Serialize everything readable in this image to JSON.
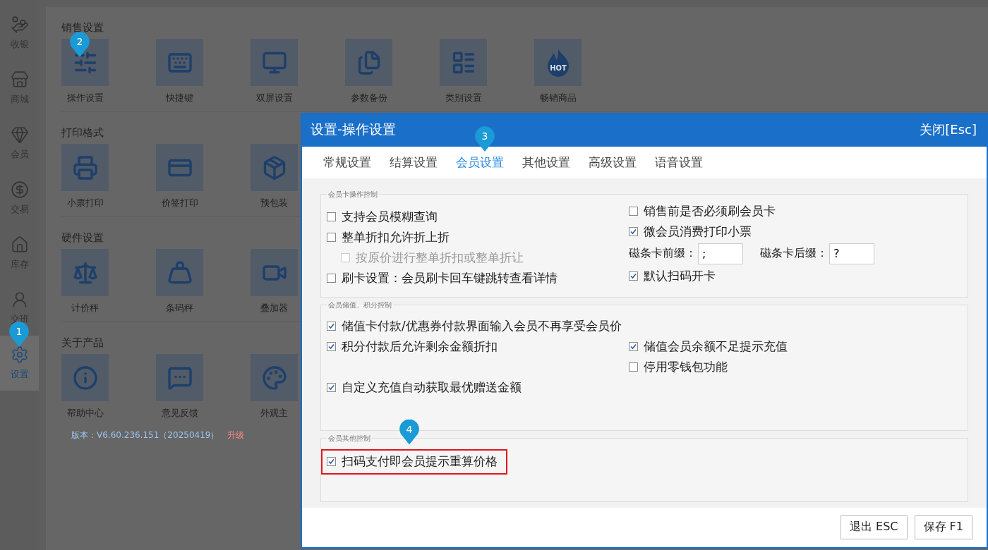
{
  "sidebar": {
    "items": [
      {
        "label": "收银",
        "selected": false
      },
      {
        "label": "商城",
        "selected": false
      },
      {
        "label": "会员",
        "selected": false
      },
      {
        "label": "交易",
        "selected": false
      },
      {
        "label": "库存",
        "selected": false
      },
      {
        "label": "交班",
        "selected": false
      },
      {
        "label": "设置",
        "selected": true,
        "callout": "1"
      }
    ]
  },
  "settings_page": {
    "sections": [
      {
        "title": "销售设置",
        "tiles": [
          {
            "label": "操作设置",
            "callout": "2"
          },
          {
            "label": "快捷键"
          },
          {
            "label": "双屏设置"
          },
          {
            "label": "参数备份"
          },
          {
            "label": "类别设置"
          },
          {
            "label": "畅销商品",
            "icon_text": "HOT"
          }
        ]
      },
      {
        "title": "打印格式",
        "tiles": [
          {
            "label": "小票打印"
          },
          {
            "label": "价签打印"
          },
          {
            "label": "预包装"
          }
        ]
      },
      {
        "title": "硬件设置",
        "tiles": [
          {
            "label": "计价秤"
          },
          {
            "label": "条码秤"
          },
          {
            "label": "叠加器"
          }
        ]
      },
      {
        "title": "关于产品",
        "tiles": [
          {
            "label": "帮助中心"
          },
          {
            "label": "意见反馈"
          },
          {
            "label": "外观主"
          }
        ]
      }
    ],
    "version": {
      "text": "版本：V6.60.236.151（20250419）",
      "link": "升级"
    }
  },
  "dialog": {
    "title": "设置-操作设置",
    "close": "关闭[Esc]",
    "tabs": [
      {
        "label": "常规设置",
        "selected": false
      },
      {
        "label": "结算设置",
        "selected": false
      },
      {
        "label": "会员设置",
        "selected": true,
        "callout": "3"
      },
      {
        "label": "其他设置",
        "selected": false
      },
      {
        "label": "高级设置",
        "selected": false
      },
      {
        "label": "语音设置",
        "selected": false
      }
    ],
    "groups": [
      {
        "legend": "会员卡操作控制",
        "columns": [
          [
            {
              "kind": "checkbox",
              "label": "支持会员模糊查询",
              "checked": false,
              "disabled": false
            },
            {
              "kind": "checkbox",
              "label": "整单折扣允许折上折",
              "checked": false,
              "disabled": false,
              "children": [
                {
                  "kind": "checkbox",
                  "label": "按原价进行整单折扣或整单折让",
                  "checked": false,
                  "disabled": true
                }
              ]
            },
            {
              "kind": "checkbox",
              "label": "刷卡设置：会员刷卡回车键跳转查看详情",
              "checked": false,
              "disabled": false
            }
          ],
          [
            {
              "kind": "checkbox",
              "label": "销售前是否必须刷会员卡",
              "checked": false,
              "disabled": false
            },
            {
              "kind": "checkbox",
              "label": "微会员消费打印小票",
              "checked": true,
              "disabled": false
            },
            {
              "kind": "fields",
              "fields": [
                {
                  "label": "磁条卡前缀：",
                  "value": ";"
                },
                {
                  "label": "磁条卡后缀：",
                  "value": "?"
                }
              ]
            },
            {
              "kind": "checkbox",
              "label": "默认扫码开卡",
              "checked": true,
              "disabled": false
            }
          ]
        ]
      },
      {
        "legend": "会员储值、积分控制",
        "rows": [
          {
            "left": {
              "kind": "checkbox",
              "label": "储值卡付款/优惠券付款界面输入会员不再享受会员价",
              "checked": true,
              "disabled": false
            }
          },
          {
            "left": {
              "kind": "checkbox",
              "label": "积分付款后允许剩余金额折扣",
              "checked": true,
              "disabled": false
            },
            "right": {
              "kind": "checkbox",
              "label": "储值会员余额不足提示充值",
              "checked": true,
              "disabled": false
            }
          },
          {
            "right": {
              "kind": "checkbox",
              "label": "停用零钱包功能",
              "checked": false,
              "disabled": false
            }
          },
          {
            "left": {
              "kind": "checkbox",
              "label": "自定义充值自动获取最优赠送金额",
              "checked": true,
              "disabled": false
            }
          }
        ]
      },
      {
        "legend": "会员其他控制",
        "rows": [
          {
            "left": {
              "kind": "checkbox",
              "label": "扫码支付即会员提示重算价格",
              "checked": true,
              "disabled": false,
              "highlighted": true,
              "callout": "4"
            }
          }
        ]
      }
    ],
    "buttons": [
      {
        "label": "退出 ESC"
      },
      {
        "label": "保存 F1"
      }
    ]
  }
}
